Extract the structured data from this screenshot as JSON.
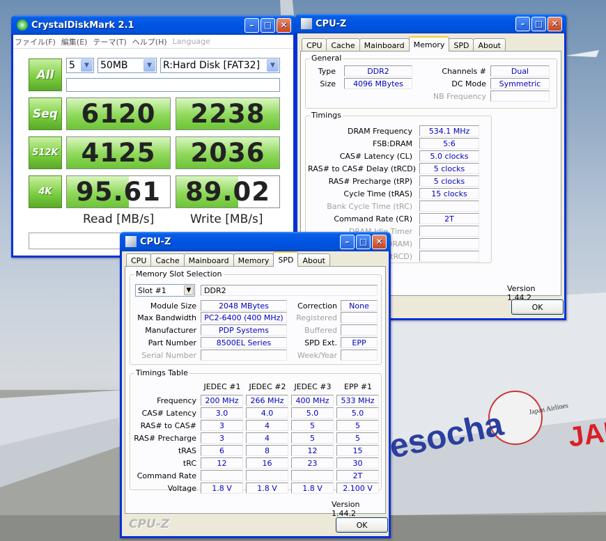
{
  "cdm": {
    "title": "CrystalDiskMark 2.1",
    "menu": [
      "ファイル(F)",
      "編集(E)",
      "テーマ(T)",
      "ヘルプ(H)",
      "Language"
    ],
    "all_label": "All",
    "count": "5",
    "size": "50MB",
    "drive": "R:Hard Disk [FAT32]",
    "rows": [
      {
        "label": "Seq",
        "read": "6120",
        "write": "2238",
        "read_fill": 1.0,
        "write_fill": 1.0
      },
      {
        "label": "512K",
        "read": "4125",
        "write": "2036",
        "read_fill": 1.0,
        "write_fill": 1.0
      },
      {
        "label": "4K",
        "read": "95.61",
        "write": "89.02",
        "read_fill": 0.6,
        "write_fill": 0.6
      }
    ],
    "read_header": "Read [MB/s]",
    "write_header": "Write [MB/s]"
  },
  "cpuz_mem": {
    "title": "CPU-Z",
    "tabs": [
      "CPU",
      "Cache",
      "Mainboard",
      "Memory",
      "SPD",
      "About"
    ],
    "active_tab": "Memory",
    "general_label": "General",
    "type_label": "Type",
    "type": "DDR2",
    "size_label": "Size",
    "size": "4096 MBytes",
    "channels_label": "Channels #",
    "channels": "Dual",
    "dcmode_label": "DC Mode",
    "dcmode": "Symmetric",
    "nbfreq_label": "NB Frequency",
    "nbfreq": "",
    "timings_label": "Timings",
    "timings": [
      {
        "label": "DRAM Frequency",
        "value": "534.1 MHz",
        "dim": false
      },
      {
        "label": "FSB:DRAM",
        "value": "5:6",
        "dim": false
      },
      {
        "label": "CAS# Latency (CL)",
        "value": "5.0 clocks",
        "dim": false
      },
      {
        "label": "RAS# to CAS# Delay (tRCD)",
        "value": "5 clocks",
        "dim": false
      },
      {
        "label": "RAS# Precharge (tRP)",
        "value": "5 clocks",
        "dim": false
      },
      {
        "label": "Cycle Time (tRAS)",
        "value": "15 clocks",
        "dim": false
      },
      {
        "label": "Bank Cycle Time (tRC)",
        "value": "",
        "dim": true
      },
      {
        "label": "Command Rate (CR)",
        "value": "2T",
        "dim": false
      },
      {
        "label": "DRAM Idle Timer",
        "value": "",
        "dim": true
      },
      {
        "label": "(tRDRAM)",
        "value": "",
        "dim": true
      },
      {
        "label": "(tRCD)",
        "value": "",
        "dim": true
      }
    ],
    "version": "Version 1.44.2",
    "ok": "OK"
  },
  "cpuz_spd": {
    "title": "CPU-Z",
    "tabs": [
      "CPU",
      "Cache",
      "Mainboard",
      "Memory",
      "SPD",
      "About"
    ],
    "active_tab": "SPD",
    "slot_group_label": "Memory Slot Selection",
    "slot": "Slot #1",
    "slot_type": "DDR2",
    "fields": {
      "module_size_label": "Module Size",
      "module_size": "2048 MBytes",
      "max_bw_label": "Max Bandwidth",
      "max_bw": "PC2-6400 (400 MHz)",
      "manufacturer_label": "Manufacturer",
      "manufacturer": "PDP Systems",
      "part_label": "Part Number",
      "part": "8500EL Series",
      "serial_label": "Serial Number",
      "serial": "",
      "correction_label": "Correction",
      "correction": "None",
      "registered_label": "Registered",
      "registered": "",
      "buffered_label": "Buffered",
      "buffered": "",
      "spdext_label": "SPD Ext.",
      "spdext": "EPP",
      "weekyear_label": "Week/Year",
      "weekyear": ""
    },
    "timings_group_label": "Timings Table",
    "columns": [
      "JEDEC #1",
      "JEDEC #2",
      "JEDEC #3",
      "EPP #1"
    ],
    "rows": [
      {
        "label": "Frequency",
        "values": [
          "200 MHz",
          "266 MHz",
          "400 MHz",
          "533 MHz"
        ]
      },
      {
        "label": "CAS# Latency",
        "values": [
          "3.0",
          "4.0",
          "5.0",
          "5.0"
        ]
      },
      {
        "label": "RAS# to CAS#",
        "values": [
          "3",
          "4",
          "5",
          "5"
        ]
      },
      {
        "label": "RAS# Precharge",
        "values": [
          "3",
          "4",
          "5",
          "5"
        ]
      },
      {
        "label": "tRAS",
        "values": [
          "6",
          "8",
          "12",
          "15"
        ]
      },
      {
        "label": "tRC",
        "values": [
          "12",
          "16",
          "23",
          "30"
        ]
      },
      {
        "label": "Command Rate",
        "values": [
          "",
          "",
          "",
          "2T"
        ]
      },
      {
        "label": "Voltage",
        "values": [
          "1.8 V",
          "1.8 V",
          "1.8 V",
          "2.100 V"
        ]
      }
    ],
    "version": "Version 1.44.2",
    "brand": "CPU-Z",
    "ok": "OK"
  },
  "background": {
    "livery_text": "esocha",
    "airline_small": "Japan Airlines",
    "tail": "JAL",
    "colors": {
      "sky": "#8fa8c4",
      "tarmac": "#9a9c98",
      "livery_blue": "#2a3f9e",
      "livery_red": "#d8202a"
    }
  }
}
